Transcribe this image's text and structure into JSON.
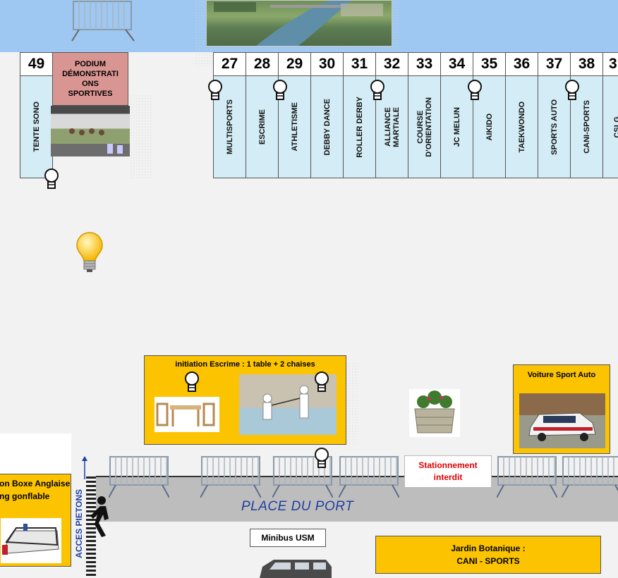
{
  "stands_top": [
    {
      "num": "27",
      "label": "MULTISPORTS",
      "bulb": true
    },
    {
      "num": "28",
      "label": "ESCRIME",
      "bulb": false
    },
    {
      "num": "29",
      "label": "ATHLETISME",
      "bulb": true
    },
    {
      "num": "30",
      "label": "DEBBY DANCE",
      "bulb": false
    },
    {
      "num": "31",
      "label": "ROLLER DERBY",
      "bulb": false
    },
    {
      "num": "32",
      "label": "ALLIANCE\nMARTIALE",
      "bulb": true
    },
    {
      "num": "33",
      "label": "COURSE\nD'ORIENTATION",
      "bulb": false
    },
    {
      "num": "34",
      "label": "JC MELUN",
      "bulb": false
    },
    {
      "num": "35",
      "label": "AIKIDO",
      "bulb": true
    },
    {
      "num": "36",
      "label": "TAEKWONDO",
      "bulb": false
    },
    {
      "num": "37",
      "label": "SPORTS AUTO",
      "bulb": false
    },
    {
      "num": "38",
      "label": "CANI-SPORTS",
      "bulb": true
    },
    {
      "num": "3",
      "label": "CSLG",
      "bulb": false
    }
  ],
  "stand49": {
    "num": "49",
    "label": "TENTE SONO"
  },
  "podium": {
    "label": "PODIUM\nDÉMONSTRATI\nONS\nSPORTIVES"
  },
  "escrime_box": {
    "title": "initiation Escrime : 1 table + 2 chaises"
  },
  "voiture_box": {
    "title": "Voiture Sport Auto"
  },
  "boxe_box": {
    "line1": "on Boxe Anglaise",
    "line2": "ng gonflable"
  },
  "parking": {
    "text": "Stationnement\ninterdit"
  },
  "place": {
    "text": "PLACE DU PORT"
  },
  "acces": {
    "text": "ACCES PIETONS"
  },
  "minibus": {
    "text": "Minibus USM"
  },
  "jardin": {
    "line1": "Jardin Botanique :",
    "line2": "CANI - SPORTS"
  },
  "colors": {
    "stand_fill": "#d4ecf5",
    "yellow": "#fcc400",
    "podium": "#d99592",
    "red_text": "#e00000",
    "blue_text": "#1f3fa0"
  }
}
